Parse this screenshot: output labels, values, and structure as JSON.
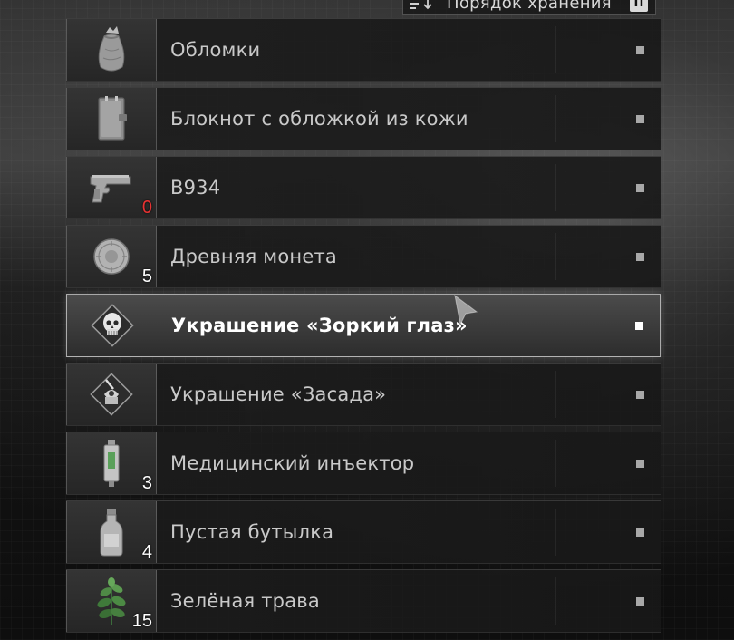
{
  "sort_button": {
    "label": "Порядок хранения",
    "key": "П",
    "icon": "sort-lines-icon"
  },
  "items": [
    {
      "name": "Обломки",
      "icon": "debris-bag-icon",
      "count": "",
      "selected": false
    },
    {
      "name": "Блокнот с обложкой из кожи",
      "icon": "leather-notebook-icon",
      "count": "",
      "selected": false
    },
    {
      "name": "B934",
      "icon": "pistol-icon",
      "count": "0",
      "count_empty": true,
      "selected": false
    },
    {
      "name": "Древняя монета",
      "icon": "ancient-coin-icon",
      "count": "5",
      "selected": false
    },
    {
      "name": "Украшение «Зоркий глаз»",
      "icon": "skull-charm-icon",
      "count": "",
      "selected": true
    },
    {
      "name": "Украшение «Засада»",
      "icon": "ambush-charm-icon",
      "count": "",
      "selected": false
    },
    {
      "name": "Медицинский инъектор",
      "icon": "medical-injector-icon",
      "count": "3",
      "selected": false
    },
    {
      "name": "Пустая бутылка",
      "icon": "empty-bottle-icon",
      "count": "4",
      "selected": false
    },
    {
      "name": "Зелёная трава",
      "icon": "green-herb-icon",
      "count": "15",
      "selected": false
    }
  ],
  "colors": {
    "accent_text": "#ffffff",
    "normal_text": "#c9c9c9",
    "empty_ammo": "#e83232"
  }
}
